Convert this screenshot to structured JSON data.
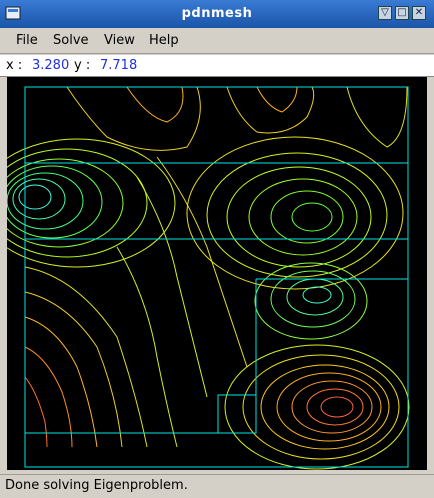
{
  "window": {
    "title": "pdnmesh"
  },
  "menu": {
    "items": [
      "File",
      "Solve",
      "View",
      "Help"
    ]
  },
  "coords": {
    "x_label": "x :",
    "x_value": "3.280",
    "y_label": "y :",
    "y_value": "7.718"
  },
  "status": {
    "text": "Done solving Eigenproblem."
  },
  "colors": {
    "mesh_outline": "#00e5e5",
    "value_text": "#2030e0",
    "canvas_bg": "#000000"
  }
}
